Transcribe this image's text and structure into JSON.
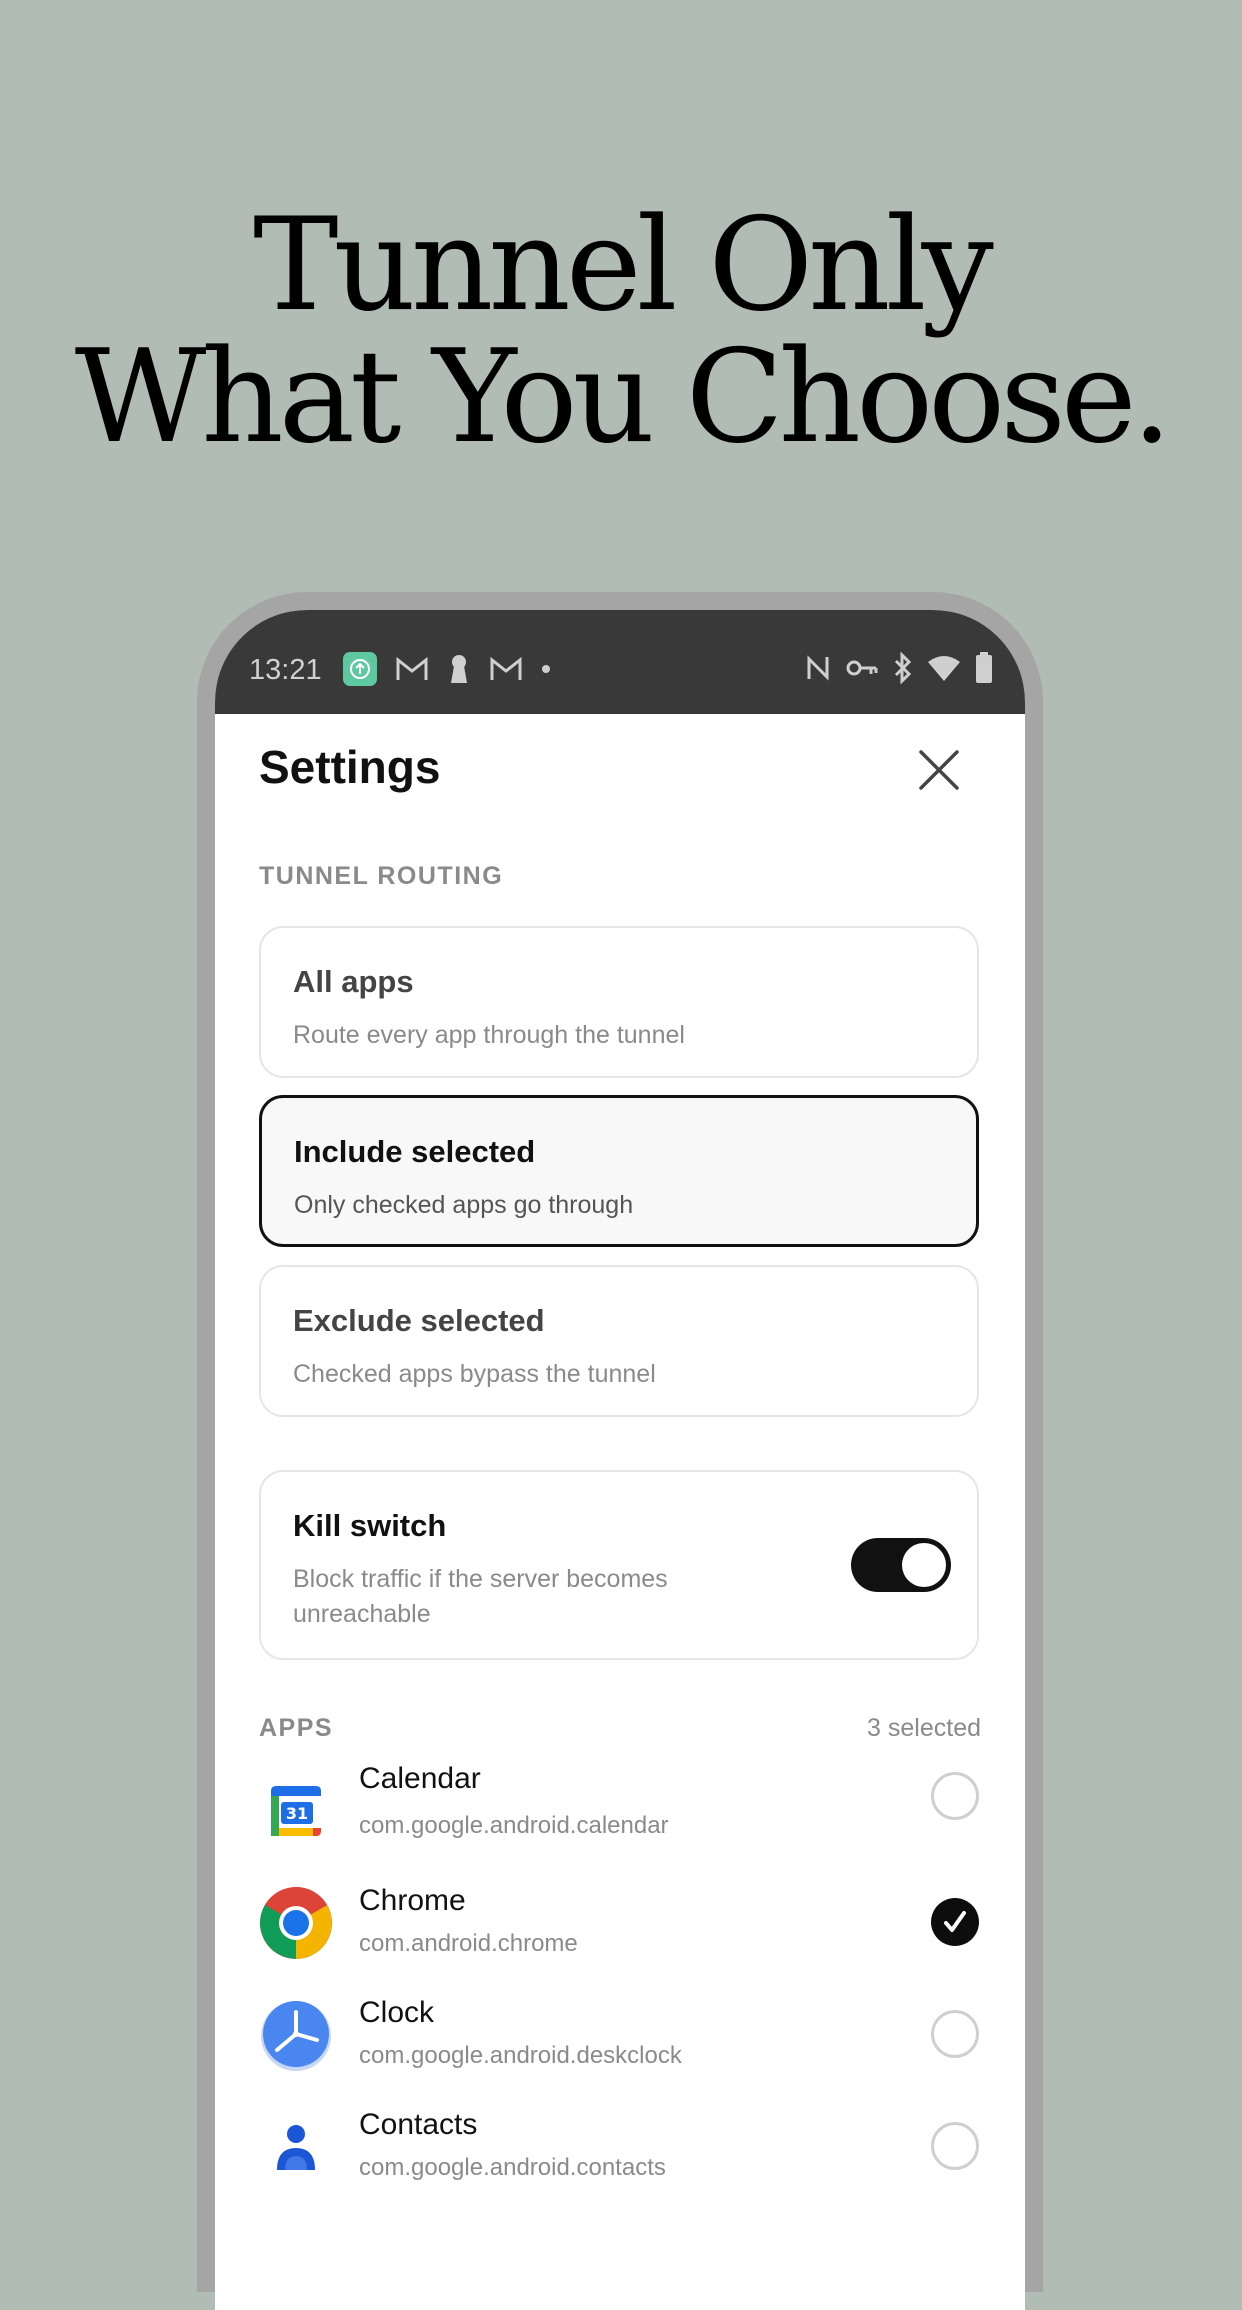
{
  "headline": {
    "line1": "Tunnel Only",
    "line2": "What You Choose."
  },
  "status_bar": {
    "time": "13:21",
    "left_icons": [
      "app-upload-icon",
      "gmail-icon",
      "keyhole-icon",
      "gmail-icon",
      "dot-icon"
    ],
    "right_icons": [
      "nfc-icon",
      "vpn-key-icon",
      "bluetooth-icon",
      "wifi-icon",
      "battery-icon"
    ]
  },
  "settings": {
    "title": "Settings",
    "close_icon": "close-icon",
    "tunnel_routing": {
      "label": "TUNNEL ROUTING",
      "options": [
        {
          "title": "All apps",
          "subtitle": "Route every app through the tunnel",
          "selected": false
        },
        {
          "title": "Include selected",
          "subtitle": "Only checked apps go through",
          "selected": true
        },
        {
          "title": "Exclude selected",
          "subtitle": "Checked apps bypass the tunnel",
          "selected": false
        }
      ]
    },
    "kill_switch": {
      "title": "Kill switch",
      "subtitle_line1": "Block traffic if the server becomes",
      "subtitle_line2": "unreachable",
      "enabled": true
    },
    "apps": {
      "label": "APPS",
      "count_text": "3 selected",
      "items": [
        {
          "name": "Calendar",
          "package": "com.google.android.calendar",
          "icon": "calendar-icon",
          "checked": false
        },
        {
          "name": "Chrome",
          "package": "com.android.chrome",
          "icon": "chrome-icon",
          "checked": true
        },
        {
          "name": "Clock",
          "package": "com.google.android.deskclock",
          "icon": "clock-icon",
          "checked": false
        },
        {
          "name": "Contacts",
          "package": "com.google.android.contacts",
          "icon": "contacts-icon",
          "checked": false
        }
      ]
    }
  },
  "colors": {
    "background": "#b1bcb5",
    "accent": "#111111",
    "status_bar": "#393939",
    "upload_icon_bg": "#5ec8a0"
  }
}
